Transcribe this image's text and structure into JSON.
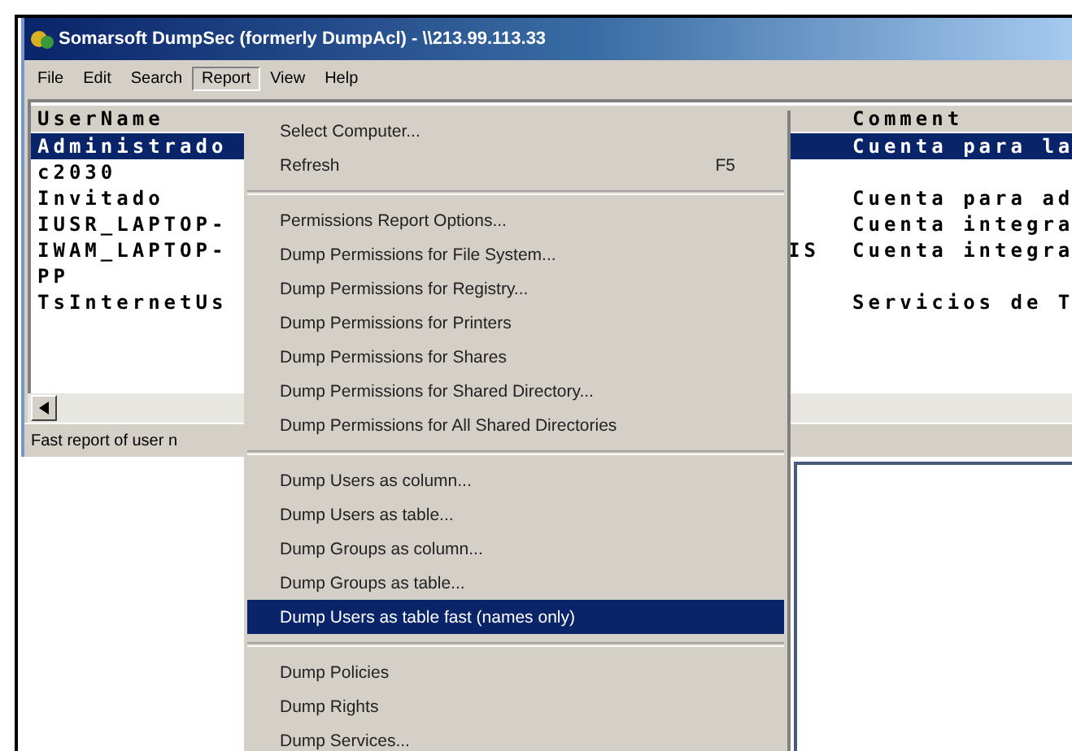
{
  "window": {
    "title": "Somarsoft DumpSec (formerly DumpAcl) - \\\\213.99.113.33"
  },
  "menubar": [
    {
      "label": "File",
      "selected": false
    },
    {
      "label": "Edit",
      "selected": false
    },
    {
      "label": "Search",
      "selected": false
    },
    {
      "label": "Report",
      "selected": true
    },
    {
      "label": "View",
      "selected": false
    },
    {
      "label": "Help",
      "selected": false
    }
  ],
  "list": {
    "headers": {
      "name": "UserName",
      "comment": "Comment"
    },
    "rows": [
      {
        "name": "Administrado",
        "comment": "Cuenta para la",
        "selected": true
      },
      {
        "name": "c2030",
        "selected": false
      },
      {
        "name": "Invitado",
        "comment": "Cuenta para ad",
        "selected": false
      },
      {
        "name": "IUSR_LAPTOP-",
        "comment": "Cuenta integra",
        "selected": false
      },
      {
        "name": "IWAM_LAPTOP-",
        "column_2": "IS",
        "comment": "Cuenta integra",
        "selected": false
      },
      {
        "name": "PP",
        "selected": false
      },
      {
        "name": "TsInternetUs",
        "comment": "Servicios de T",
        "selected": false
      }
    ]
  },
  "status_bar": "Fast report of user n",
  "menu": {
    "items": [
      {
        "kind": "item",
        "label": "Select Computer...",
        "selected": false
      },
      {
        "kind": "item",
        "label": "Refresh",
        "shortcut": "F5",
        "selected": false
      },
      {
        "kind": "separator"
      },
      {
        "kind": "item",
        "label": "Permissions Report Options...",
        "selected": false
      },
      {
        "kind": "item",
        "label": "Dump Permissions for File System...",
        "selected": false
      },
      {
        "kind": "item",
        "label": "Dump Permissions for Registry...",
        "selected": false
      },
      {
        "kind": "item",
        "label": "Dump Permissions for Printers",
        "selected": false
      },
      {
        "kind": "item",
        "label": "Dump Permissions for Shares",
        "selected": false
      },
      {
        "kind": "item",
        "label": "Dump Permissions for Shared Directory...",
        "selected": false
      },
      {
        "kind": "item",
        "label": "Dump Permissions for All Shared Directories",
        "selected": false
      },
      {
        "kind": "separator"
      },
      {
        "kind": "item",
        "label": "Dump Users as column...",
        "selected": false
      },
      {
        "kind": "item",
        "label": "Dump Users as table...",
        "selected": false
      },
      {
        "kind": "item",
        "label": "Dump Groups as column...",
        "selected": false
      },
      {
        "kind": "item",
        "label": "Dump Groups as table...",
        "selected": false
      },
      {
        "kind": "item",
        "label": "Dump Users as table fast (names only)",
        "selected": true
      },
      {
        "kind": "separator"
      },
      {
        "kind": "item",
        "label": "Dump Policies",
        "selected": false
      },
      {
        "kind": "item",
        "label": "Dump Rights",
        "selected": false
      },
      {
        "kind": "item",
        "label": "Dump Services...",
        "selected": false
      }
    ]
  }
}
